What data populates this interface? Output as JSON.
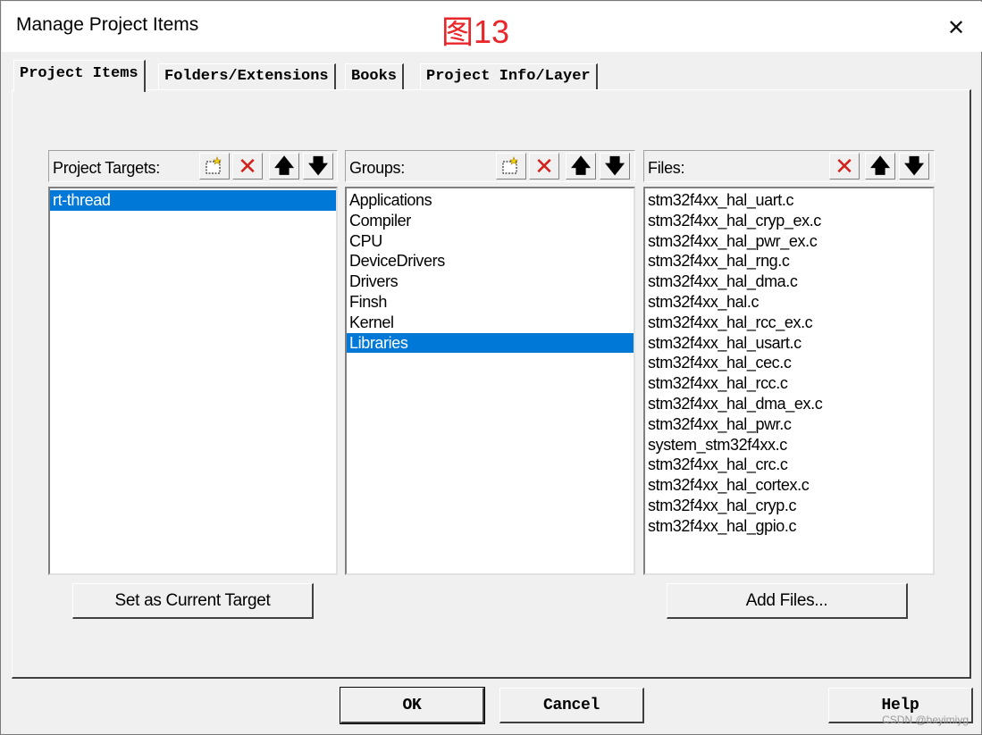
{
  "window": {
    "title": "Manage Project Items",
    "annotation": "图13",
    "close_glyph": "✕"
  },
  "tabs": [
    {
      "label": "Project Items",
      "active": true
    },
    {
      "label": "Folders/Extensions",
      "active": false
    },
    {
      "label": "Books",
      "active": false
    },
    {
      "label": "Project Info/Layer",
      "active": false
    }
  ],
  "targets": {
    "label": "Project Targets:",
    "items": [
      "rt-thread"
    ],
    "selected_index": 0,
    "button": "Set as Current Target"
  },
  "groups": {
    "label": "Groups:",
    "items": [
      "Applications",
      "Compiler",
      "CPU",
      "DeviceDrivers",
      "Drivers",
      "Finsh",
      "Kernel",
      "Libraries"
    ],
    "selected_index": 7
  },
  "files": {
    "label": "Files:",
    "items": [
      "stm32f4xx_hal_uart.c",
      "stm32f4xx_hal_cryp_ex.c",
      "stm32f4xx_hal_pwr_ex.c",
      "stm32f4xx_hal_rng.c",
      "stm32f4xx_hal_dma.c",
      "stm32f4xx_hal.c",
      "stm32f4xx_hal_rcc_ex.c",
      "stm32f4xx_hal_usart.c",
      "stm32f4xx_hal_cec.c",
      "stm32f4xx_hal_rcc.c",
      "stm32f4xx_hal_dma_ex.c",
      "stm32f4xx_hal_pwr.c",
      "system_stm32f4xx.c",
      "stm32f4xx_hal_crc.c",
      "stm32f4xx_hal_cortex.c",
      "stm32f4xx_hal_cryp.c",
      "stm32f4xx_hal_gpio.c"
    ],
    "button": "Add Files..."
  },
  "toolbar_icons": {
    "new": "new-item-icon",
    "delete": "delete-x-icon",
    "up": "move-up-arrow-icon",
    "down": "move-down-arrow-icon",
    "delete_color": "#d2221b"
  },
  "footer": {
    "ok": "OK",
    "cancel": "Cancel",
    "help": "Help"
  },
  "watermark": "CSDN @beyimiyg",
  "colors": {
    "selection": "#0078d7",
    "annotation": "#e8262a",
    "dialog_bg": "#f0f0f0"
  }
}
